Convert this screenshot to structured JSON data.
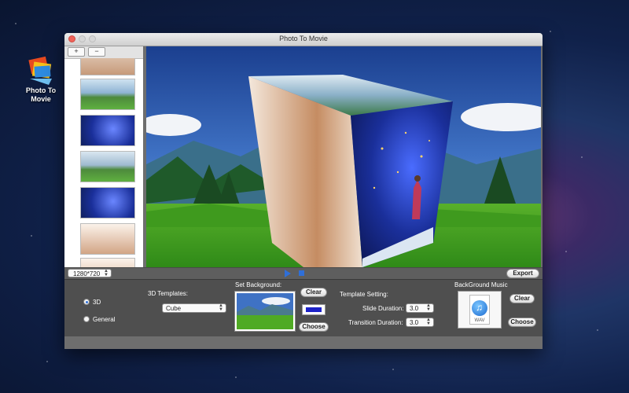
{
  "desktop": {
    "app_icon_label_line1": "Photo To",
    "app_icon_label_line2": "Movie"
  },
  "window": {
    "title": "Photo To Movie"
  },
  "sidebar": {
    "add_label": "+",
    "remove_label": "−"
  },
  "controls": {
    "resolution": "1280*720",
    "export_label": "Export"
  },
  "settings": {
    "mode_3d_label": "3D",
    "mode_general_label": "General",
    "templates_label": "3D Templates:",
    "template_value": "Cube",
    "set_background_label": "Set Background:",
    "bg_clear_label": "Clear",
    "bg_choose_label": "Choose",
    "template_setting_label": "Template Setting:",
    "slide_duration_label": "Slide Duration:",
    "slide_duration_value": "3.0",
    "transition_duration_label": "Transition Duration:",
    "transition_duration_value": "3.0",
    "music_label": "BackGround Music",
    "music_file_type": "WAV",
    "music_clear_label": "Clear",
    "music_choose_label": "Choose",
    "background_color": "#1d22c8",
    "accent_color": "#2f6fd8"
  }
}
